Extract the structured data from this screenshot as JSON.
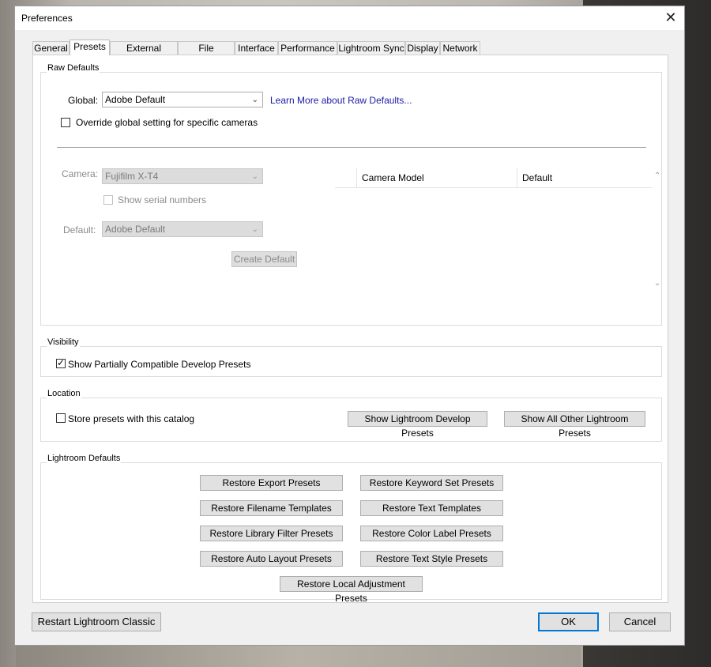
{
  "window": {
    "title": "Preferences"
  },
  "tabs": [
    "General",
    "Presets",
    "External Editing",
    "File Handling",
    "Interface",
    "Performance",
    "Lightroom Sync",
    "Display",
    "Network"
  ],
  "active_tab": "Presets",
  "raw_defaults": {
    "group_label": "Raw Defaults",
    "global_label": "Global:",
    "global_value": "Adobe Default",
    "learn_more_link": "Learn More about Raw Defaults...",
    "override_label": "Override global setting for specific cameras",
    "override_checked": false,
    "camera_label": "Camera:",
    "camera_value": "Fujifilm X-T4",
    "serial_label": "Show serial numbers",
    "default_label": "Default:",
    "default_value": "Adobe Default",
    "create_default_button": "Create Default",
    "table_columns": [
      "Camera Model",
      "Default"
    ]
  },
  "visibility": {
    "group_label": "Visibility",
    "show_partial_label": "Show Partially Compatible Develop Presets",
    "show_partial_checked": true
  },
  "location": {
    "group_label": "Location",
    "store_label": "Store presets with this catalog",
    "store_checked": false,
    "show_develop_button": "Show Lightroom Develop Presets",
    "show_other_button": "Show All Other Lightroom Presets"
  },
  "lightroom_defaults": {
    "group_label": "Lightroom Defaults",
    "buttons": [
      "Restore Export Presets",
      "Restore Keyword Set Presets",
      "Restore Filename Templates",
      "Restore Text Templates",
      "Restore Library Filter Presets",
      "Restore Color Label Presets",
      "Restore Auto Layout Presets",
      "Restore Text Style Presets",
      "Restore Local Adjustment Presets"
    ]
  },
  "footer": {
    "restart_button": "Restart Lightroom Classic",
    "ok_button": "OK",
    "cancel_button": "Cancel"
  },
  "icons": {
    "close": "close-icon",
    "dropdown": "chevron-down-icon",
    "check": "checkmark-icon",
    "scroll_up": "chevron-up-icon"
  },
  "colors": {
    "link": "#1a1aa6",
    "default_button_border": "#0078d7"
  }
}
